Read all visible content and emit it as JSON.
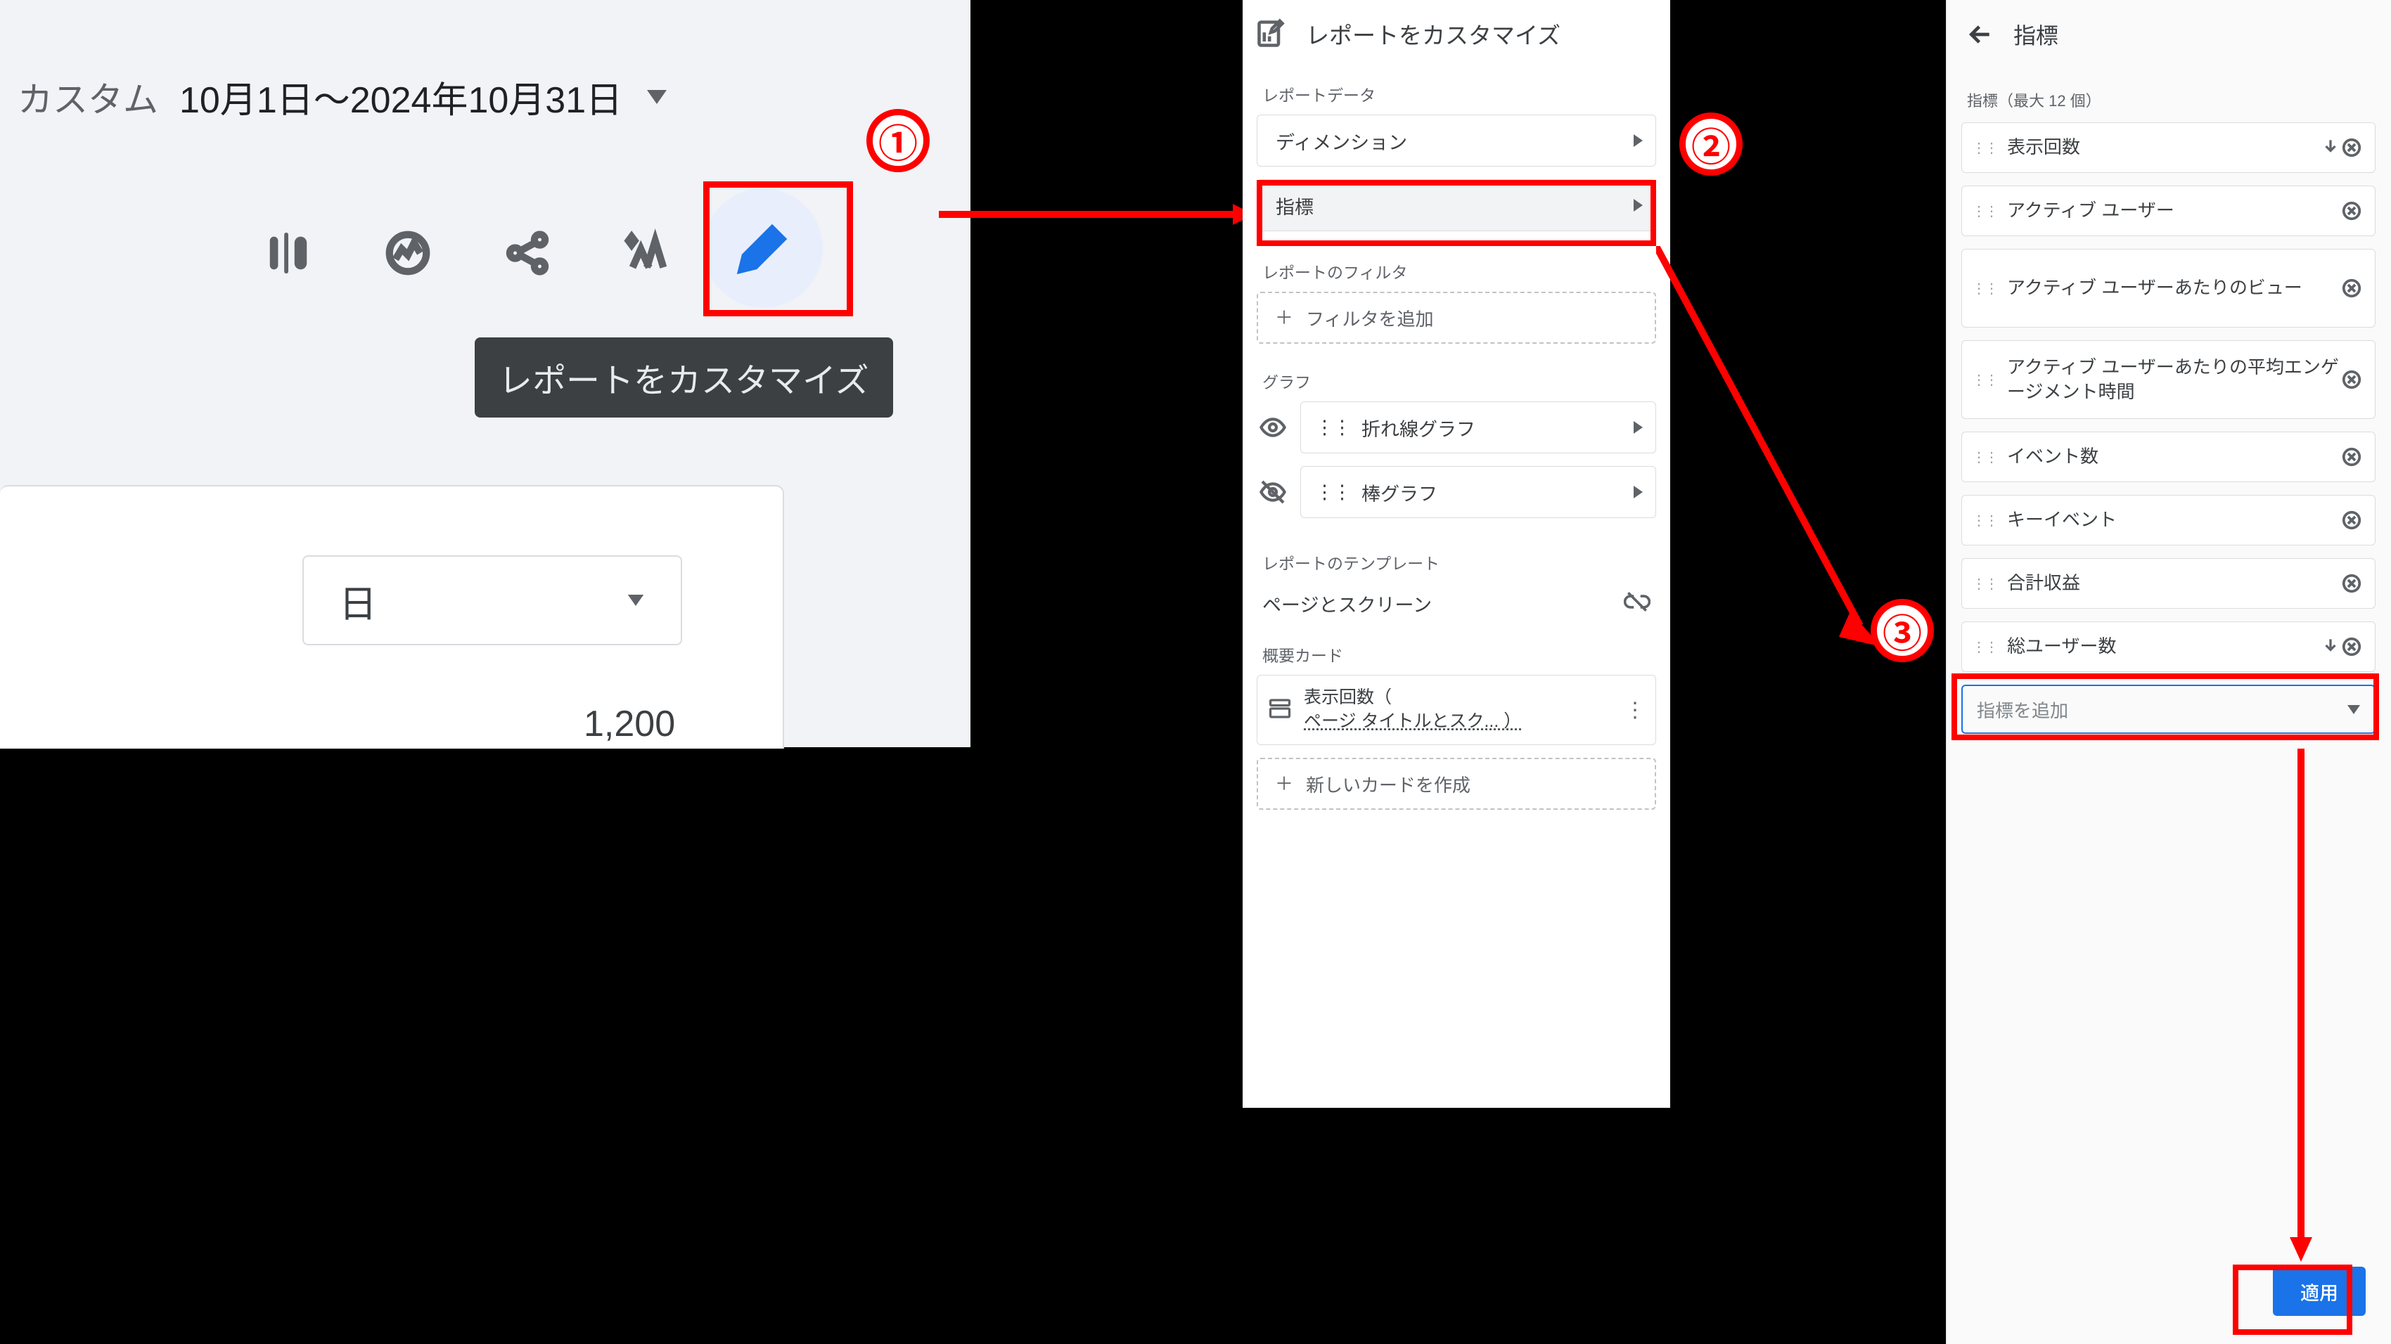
{
  "left": {
    "range_prefix": "カスタム",
    "range_text": "10月1日～2024年10月31日",
    "tooltip": "レポートをカスタマイズ",
    "day_label": "日",
    "number": "1,200"
  },
  "customize": {
    "title": "レポートをカスタマイズ",
    "sec_data": "レポートデータ",
    "dimensions": "ディメンション",
    "metrics": "指標",
    "sec_filter": "レポートのフィルタ",
    "add_filter": "フィルタを追加",
    "sec_chart": "グラフ",
    "chart_line": "折れ線グラフ",
    "chart_bar": "棒グラフ",
    "sec_template": "レポートのテンプレート",
    "template_value": "ページとスクリーン",
    "sec_cards": "概要カード",
    "card1_line1": "表示回数（",
    "card1_line2": "ページ タイトルとスク...   ）",
    "new_card": "新しいカードを作成"
  },
  "metrics": {
    "title": "指標",
    "subtitle": "指標（最大 12 個）",
    "items": [
      "表示回数",
      "アクティブ ユーザー",
      "アクティブ ユーザーあたりのビュー",
      "アクティブ ユーザーあたりの平均エンゲージメント時間",
      "イベント数",
      "キーイベント",
      "合計収益",
      "総ユーザー数"
    ],
    "add_placeholder": "指標を追加",
    "apply": "適用"
  },
  "badges": {
    "b1": "①",
    "b2": "②",
    "b3": "③"
  }
}
